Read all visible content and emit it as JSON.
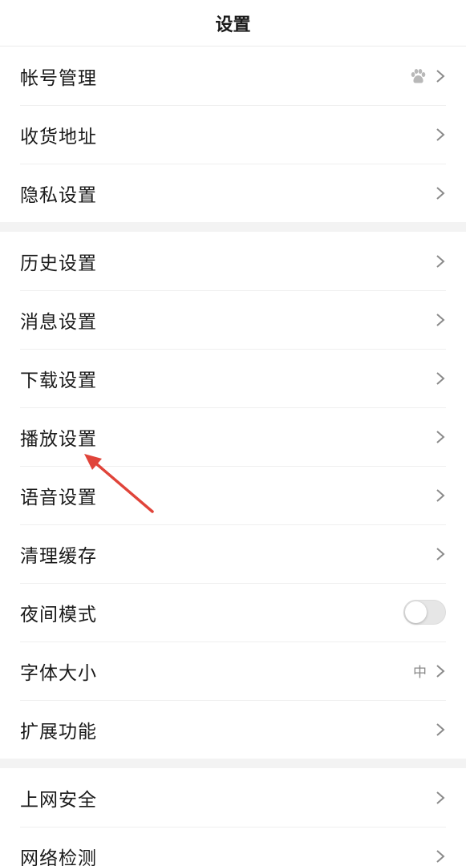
{
  "header": {
    "title": "设置"
  },
  "groups": [
    {
      "items": [
        {
          "label": "帐号管理",
          "accessory": "baidu-icon"
        },
        {
          "label": "收货地址"
        },
        {
          "label": "隐私设置"
        }
      ]
    },
    {
      "items": [
        {
          "label": "历史设置"
        },
        {
          "label": "消息设置"
        },
        {
          "label": "下载设置"
        },
        {
          "label": "播放设置"
        },
        {
          "label": "语音设置"
        },
        {
          "label": "清理缓存"
        },
        {
          "label": "夜间模式",
          "toggle": "off"
        },
        {
          "label": "字体大小",
          "value": "中"
        },
        {
          "label": "扩展功能"
        }
      ]
    },
    {
      "items": [
        {
          "label": "上网安全"
        },
        {
          "label": "网络检测"
        }
      ]
    }
  ],
  "annotation": {
    "target": "播放设置",
    "color": "#e0443a"
  },
  "colors": {
    "text": "#1a1a1a",
    "secondary": "#888888",
    "separator_band": "#f3f3f3",
    "chevron": "#8a8a8a"
  }
}
